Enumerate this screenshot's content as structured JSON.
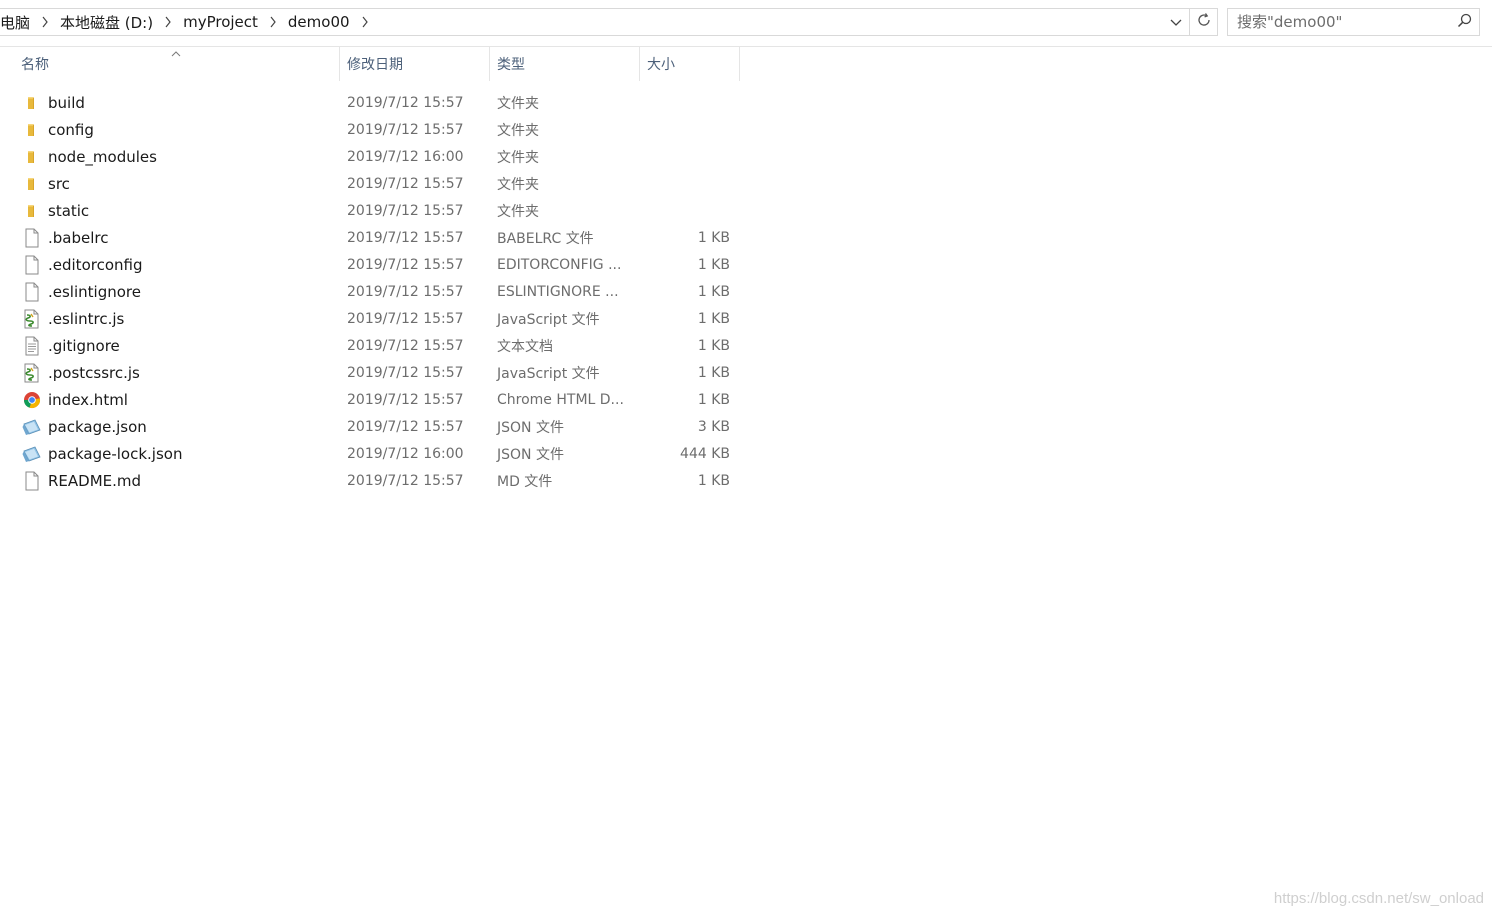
{
  "breadcrumb": {
    "items": [
      "电脑",
      "本地磁盘 (D:)",
      "myProject",
      "demo00"
    ]
  },
  "search": {
    "placeholder": "搜索\"demo00\""
  },
  "columns": {
    "name": "名称",
    "date": "修改日期",
    "type": "类型",
    "size": "大小"
  },
  "files": [
    {
      "name": "build",
      "date": "2019/7/12 15:57",
      "type": "文件夹",
      "size": "",
      "icon": "folder-icon"
    },
    {
      "name": "config",
      "date": "2019/7/12 15:57",
      "type": "文件夹",
      "size": "",
      "icon": "folder-icon"
    },
    {
      "name": "node_modules",
      "date": "2019/7/12 16:00",
      "type": "文件夹",
      "size": "",
      "icon": "folder-icon"
    },
    {
      "name": "src",
      "date": "2019/7/12 15:57",
      "type": "文件夹",
      "size": "",
      "icon": "folder-icon"
    },
    {
      "name": "static",
      "date": "2019/7/12 15:57",
      "type": "文件夹",
      "size": "",
      "icon": "folder-icon"
    },
    {
      "name": ".babelrc",
      "date": "2019/7/12 15:57",
      "type": "BABELRC 文件",
      "size": "1 KB",
      "icon": "blank-file-icon"
    },
    {
      "name": ".editorconfig",
      "date": "2019/7/12 15:57",
      "type": "EDITORCONFIG ...",
      "size": "1 KB",
      "icon": "blank-file-icon"
    },
    {
      "name": ".eslintignore",
      "date": "2019/7/12 15:57",
      "type": "ESLINTIGNORE ...",
      "size": "1 KB",
      "icon": "blank-file-icon"
    },
    {
      "name": ".eslintrc.js",
      "date": "2019/7/12 15:57",
      "type": "JavaScript 文件",
      "size": "1 KB",
      "icon": "script-file-icon"
    },
    {
      "name": ".gitignore",
      "date": "2019/7/12 15:57",
      "type": "文本文档",
      "size": "1 KB",
      "icon": "text-file-icon"
    },
    {
      "name": ".postcssrc.js",
      "date": "2019/7/12 15:57",
      "type": "JavaScript 文件",
      "size": "1 KB",
      "icon": "script-file-icon"
    },
    {
      "name": "index.html",
      "date": "2019/7/12 15:57",
      "type": "Chrome HTML D...",
      "size": "1 KB",
      "icon": "chrome-icon"
    },
    {
      "name": "package.json",
      "date": "2019/7/12 15:57",
      "type": "JSON 文件",
      "size": "3 KB",
      "icon": "json-file-icon"
    },
    {
      "name": "package-lock.json",
      "date": "2019/7/12 16:00",
      "type": "JSON 文件",
      "size": "444 KB",
      "icon": "json-file-icon"
    },
    {
      "name": "README.md",
      "date": "2019/7/12 15:57",
      "type": "MD 文件",
      "size": "1 KB",
      "icon": "blank-file-icon"
    }
  ],
  "watermark": "https://blog.csdn.net/sw_onload"
}
